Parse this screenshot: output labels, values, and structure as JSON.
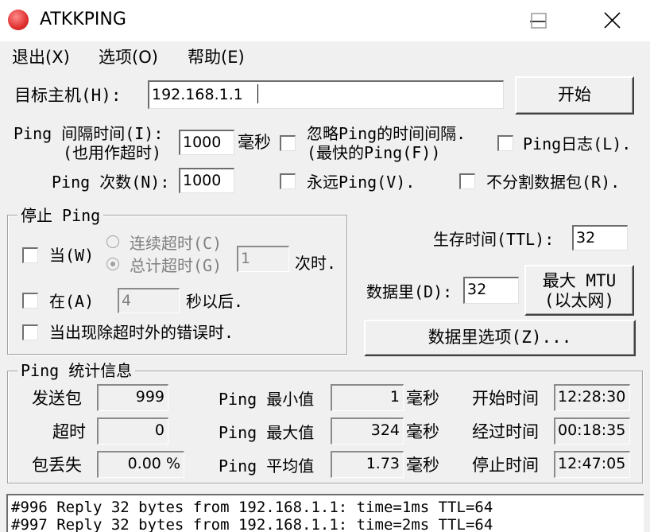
{
  "window": {
    "title": "ATKKPING"
  },
  "menu": [
    "退出(X)",
    "选项(O)",
    "帮助(E)"
  ],
  "host": {
    "label": "目标主机(H):",
    "value": "192.168.1.1",
    "start_button": "开始"
  },
  "interval": {
    "label_line1": "Ping 间隔时间(I):",
    "label_line2": "(也用作超时)",
    "value": "1000",
    "unit": "毫秒"
  },
  "ignore_interval": {
    "label_line1": "忽略Ping的时间间隔.",
    "label_line2": "(最快的Ping(F))"
  },
  "ping_log": {
    "label": "Ping日志(L)."
  },
  "count": {
    "label": "Ping 次数(N):",
    "value": "1000"
  },
  "forever": {
    "label": "永远Ping(V)."
  },
  "no_fragment": {
    "label": "不分割数据包(R)."
  },
  "stop_group": {
    "title": "停止 Ping",
    "when_label": "当(W)",
    "consecutive_label": "连续超时(C)",
    "total_label": "总计超时(G)",
    "timeout_value": "1",
    "times_suffix": "次时.",
    "at_label": "在(A)",
    "seconds_value": "4",
    "seconds_suffix": "秒以后.",
    "error_label": "当出现除超时外的错误时."
  },
  "ttl": {
    "label": "生存时间(TTL):",
    "value": "32"
  },
  "data": {
    "label": "数据里(D):",
    "value": "32",
    "mtu_line1": "最大 MTU",
    "mtu_line2": "(以太网)",
    "options_button": "数据里选项(Z)..."
  },
  "stats": {
    "title": "Ping  统计信息",
    "sent_label": "发送包",
    "sent_value": "999",
    "timeout_label": "超时",
    "timeout_value": "0",
    "loss_label": "包丢失",
    "loss_value": "0.00 %",
    "min_label": "Ping 最小值",
    "min_value": "1",
    "min_unit": "毫秒",
    "max_label": "Ping 最大值",
    "max_value": "324",
    "max_unit": "毫秒",
    "avg_label": "Ping 平均值",
    "avg_value": "1.73",
    "avg_unit": "毫秒",
    "start_label": "开始时间",
    "start_value": "12:28:30",
    "elapsed_label": "经过时间",
    "elapsed_value": "00:18:35",
    "stop_label": "停止时间",
    "stop_value": "12:47:05"
  },
  "log": [
    "#996 Reply 32 bytes from 192.168.1.1: time=1ms TTL=64",
    "#997 Reply 32 bytes from 192.168.1.1: time=2ms TTL=64"
  ]
}
